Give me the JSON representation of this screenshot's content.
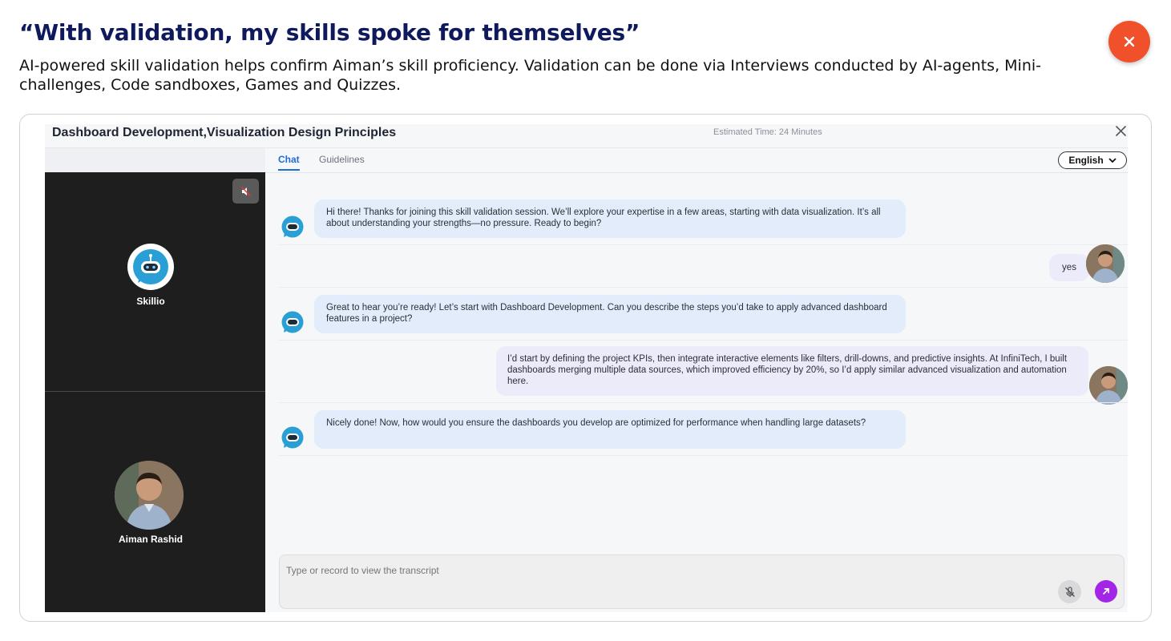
{
  "headline": "“With validation, my skills spoke for themselves”",
  "subtext": "AI-powered skill validation helps confirm Aiman’s skill proficiency. Validation can be done via Interviews conducted by AI-agents, Mini-challenges, Code sandboxes, Games and Quizzes.",
  "colors": {
    "accent_orange": "#f0512a",
    "navy": "#0f1a5c",
    "tab_blue": "#1e6cd6",
    "send_purple": "#a326e6",
    "bot_blue": "#2a9fd6"
  },
  "app": {
    "title": "Dashboard Development,Visualization Design Principles",
    "estimated_time": "Estimated Time: 24 Minutes",
    "close_icon": "close-icon",
    "tabs": [
      {
        "label": "Chat",
        "active": true
      },
      {
        "label": "Guidelines",
        "active": false
      }
    ],
    "language": "English",
    "participants": {
      "bot_name": "Skillio",
      "user_name": "Aiman Rashid",
      "mute_icon": "speaker-muted-icon"
    },
    "messages": [
      {
        "from": "bot",
        "text": "Hi there! Thanks for joining this skill validation session. We’ll explore your expertise in a few areas, starting with data visualization. It’s all about understanding your strengths—no pressure. Ready to begin?"
      },
      {
        "from": "user",
        "text": "yes"
      },
      {
        "from": "bot",
        "text": "Great to hear you’re ready! Let’s start with Dashboard Development. Can you describe the steps you’d take to apply advanced dashboard features in a project?"
      },
      {
        "from": "user",
        "text": "I’d start by defining the project KPIs, then integrate interactive elements like filters, drill-downs, and predictive insights. At InfiniTech, I built dashboards merging multiple data sources, which improved efficiency by 20%, so I’d apply similar advanced visualization and automation here."
      },
      {
        "from": "bot",
        "text": "Nicely done! Now, how would you ensure the dashboards you develop are optimized for performance when handling large datasets?"
      }
    ],
    "input": {
      "placeholder": "Type or record to view the transcript",
      "mic_icon": "mic-off-icon",
      "send_icon": "send-arrow-icon"
    }
  }
}
